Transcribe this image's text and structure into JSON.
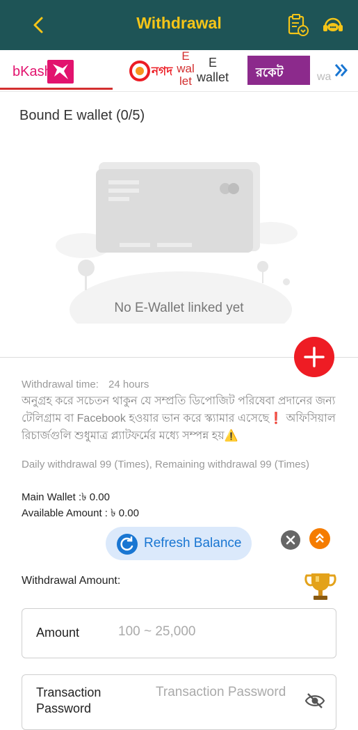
{
  "header": {
    "title": "Withdrawal"
  },
  "tabs": [
    {
      "label": "bKash"
    },
    {
      "label": "E\nwal\nlet"
    },
    {
      "label": "নগদ"
    },
    {
      "label": "E\nwallet"
    },
    {
      "label": "রকেট"
    },
    {
      "label": "wa"
    }
  ],
  "wallet": {
    "section_title": "Bound E wallet (0/5)",
    "empty_text": "No E-Wallet linked yet"
  },
  "info": {
    "withdrawal_time_label": "Withdrawal time:",
    "withdrawal_time_value": "24 hours",
    "notice": "অনুগ্রহ করে সচেতন থাকুন যে সম্প্রতি ডিপোজিট পরিষেবা প্রদানের জন্য টেলিগ্রাম বা Facebook হওয়ার ভান করে স্ক্যামার এসেছে❗ অফিসিয়াল রিচার্জগুলি শুধুমাত্র প্ল্যাটফর্মের মধ্যে সম্পন্ন হয়⚠️",
    "daily_limit": "Daily withdrawal 99 (Times), Remaining withdrawal 99 (Times)",
    "main_wallet": "Main Wallet :৳ 0.00",
    "available_amount": "Available Amount : ৳ 0.00"
  },
  "refresh": {
    "label": "Refresh Balance"
  },
  "form": {
    "amount_section_label": "Withdrawal Amount:",
    "amount_label": "Amount",
    "amount_placeholder": "100 ~ 25,000",
    "password_label": "Transaction\nPassword",
    "password_placeholder": "Transaction Password"
  },
  "colors": {
    "header_bg": "#1e5456",
    "accent": "#f5c518",
    "add_button": "#ee1c24",
    "refresh_bg": "#dbe9fb"
  }
}
